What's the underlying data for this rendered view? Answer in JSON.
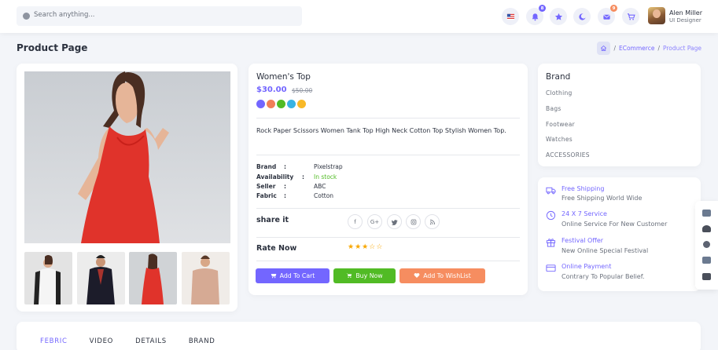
{
  "header": {
    "search_placeholder": "Search anything...",
    "notification_count": "8",
    "message_count": "9",
    "user_name": "Alen Miller",
    "user_role": "UI Designer",
    "icons": [
      "flag-icon",
      "bell-icon",
      "star-icon",
      "moon-icon",
      "mail-icon",
      "cart-icon"
    ]
  },
  "page": {
    "title": "Product Page",
    "breadcrumb": [
      "ECommerce",
      "Product Page"
    ]
  },
  "product": {
    "name": "Women's Top",
    "price": "$30.00",
    "old_price": "$50.00",
    "colors": [
      "#7366ff",
      "#f17f58",
      "#51bb25",
      "#38b3e3",
      "#f8b928"
    ],
    "description": "Rock Paper Scissors Women Tank Top High Neck Cotton Top Stylish Women Top.",
    "specs": [
      {
        "label": "Brand",
        "value": "Pixelstrap"
      },
      {
        "label": "Availability",
        "value": "In stock"
      },
      {
        "label": "Seller",
        "value": "ABC"
      },
      {
        "label": "Fabric",
        "value": "Cotton"
      }
    ],
    "share_label": "share it",
    "social": [
      "f",
      "G+",
      "twitter-icon",
      "instagram-icon",
      "rss-icon"
    ],
    "rate_label": "Rate Now",
    "rating": 3,
    "rating_max": 5,
    "buttons": {
      "add_to_cart": "Add To Cart",
      "buy_now": "Buy Now",
      "wishlist": "Add To WishList"
    }
  },
  "brand_panel": {
    "title": "Brand",
    "items": [
      "Clothing",
      "Bags",
      "Footwear",
      "Watches",
      "ACCESSORIES"
    ]
  },
  "shipping": [
    {
      "title": "Free Shipping",
      "subtitle": "Free Shipping World Wide"
    },
    {
      "title": "24 X 7 Service",
      "subtitle": "Online Service For New Customer"
    },
    {
      "title": "Festival Offer",
      "subtitle": "New Online Special Festival"
    },
    {
      "title": "Online Payment",
      "subtitle": "Contrary To Popular Belief."
    }
  ],
  "tabs": [
    "FEBRIC",
    "VIDEO",
    "DETAILS",
    "BRAND"
  ],
  "colors": {
    "accent": "#7366ff",
    "success": "#51bb25",
    "warning": "#f8a700",
    "wishlist": "#f68d60"
  }
}
